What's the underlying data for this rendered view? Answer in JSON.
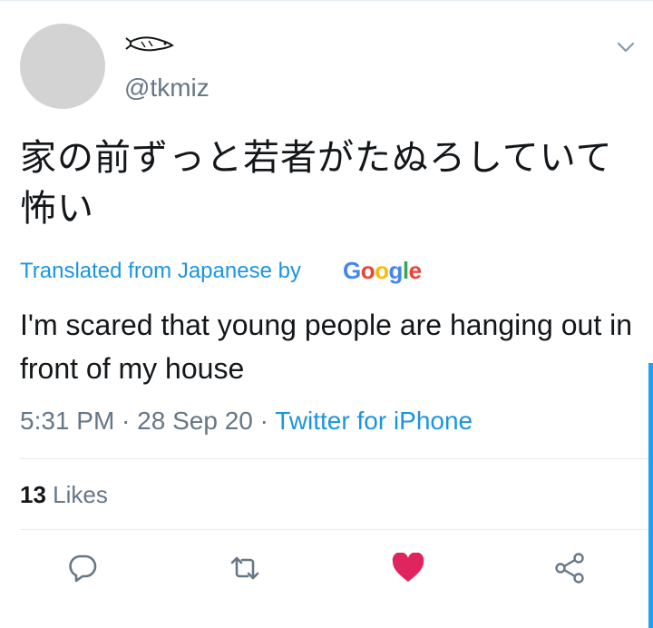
{
  "tweet": {
    "handle": "@tkmiz",
    "text": "家の前ずっと若者がたぬろしていて\n怖い",
    "translated_label": "Translated from Japanese by",
    "google_logo": {
      "letters": [
        "G",
        "o",
        "o",
        "g",
        "l",
        "e"
      ],
      "colors": [
        "#4285F4",
        "#EA4335",
        "#FBBC05",
        "#4285F4",
        "#34A853",
        "#EA4335"
      ]
    },
    "translation": "I'm scared that young people are hanging out in front of my house",
    "time": "5:31 PM",
    "separator": " · ",
    "date": "28 Sep 20",
    "source": "Twitter for iPhone",
    "likes_count": "13",
    "likes_label": "Likes"
  },
  "actions": {
    "reply_icon": "reply-icon",
    "retweet_icon": "retweet-icon",
    "like_icon": "heart-icon",
    "share_icon": "share-icon",
    "like_color": "#e0245e",
    "icon_color": "#657786"
  },
  "colors": {
    "link": "#1b95e0",
    "secondary_text": "#657786",
    "scrollbar": "#1da1f2"
  }
}
